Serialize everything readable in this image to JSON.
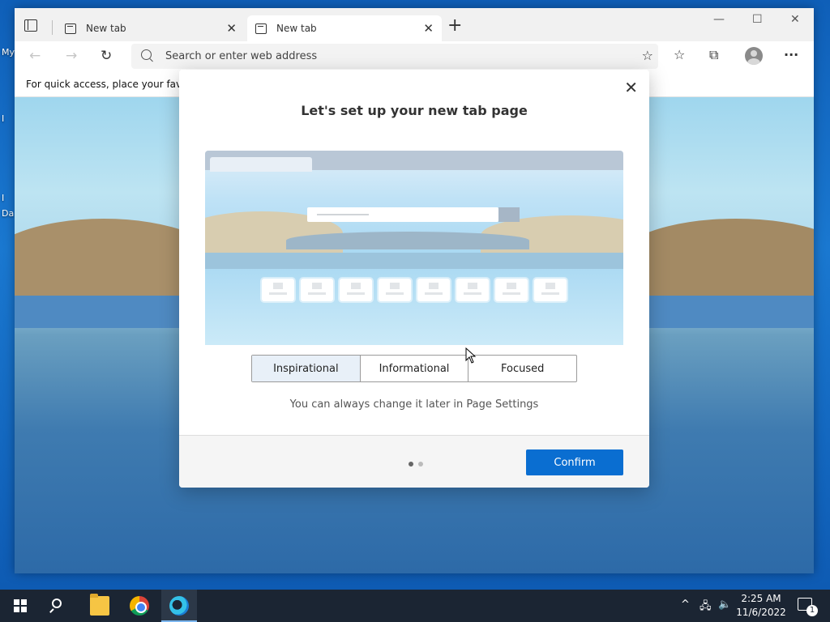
{
  "desktop": {
    "labels": [
      "My",
      "I",
      "I",
      "Da"
    ]
  },
  "browser": {
    "tabs": [
      {
        "label": "New tab"
      },
      {
        "label": "New tab"
      }
    ],
    "window_controls": {
      "minimize": "—",
      "maximize": "☐",
      "close": "✕"
    },
    "address": {
      "placeholder": "Search or enter web address"
    },
    "favorites_bar_text": "For quick access, place your favorit"
  },
  "dialog": {
    "title": "Let's set up your new tab page",
    "layouts": [
      "Inspirational",
      "Informational",
      "Focused"
    ],
    "selected_layout": "Inspirational",
    "hint": "You can always change it later in Page Settings",
    "confirm_label": "Confirm",
    "steps": {
      "current": 1,
      "total": 2
    }
  },
  "taskbar": {
    "time": "2:25 AM",
    "date": "11/6/2022",
    "notification_count": "1"
  },
  "colors": {
    "accent": "#0a6ed1",
    "taskbar": "#1b2533",
    "selected_segment": "#e8f0f8"
  }
}
